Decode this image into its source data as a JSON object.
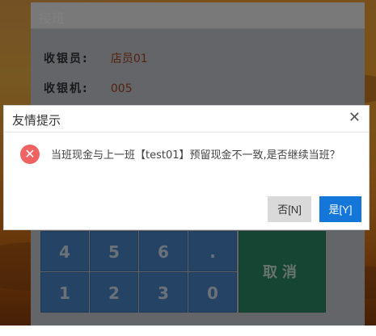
{
  "shift_panel": {
    "title": "接班",
    "cashier_label": "收银员:",
    "cashier_value": "店员01",
    "register_label": "收银机:",
    "register_value": "005",
    "keypad": {
      "keys_row1": [
        "4",
        "5",
        "6",
        "."
      ],
      "keys_row2": [
        "1",
        "2",
        "3",
        "0"
      ],
      "cancel_label": "取消"
    }
  },
  "dialog": {
    "title": "友情提示",
    "close_icon": "close-icon",
    "error_icon": "error-icon",
    "message": "当班现金与上一班【test01】预留现金不一致,是否继续当班？",
    "no_label": "否[N]",
    "yes_label": "是[Y]"
  },
  "colors": {
    "primary_button": "#1476d8",
    "error_icon": "#f06363",
    "keypad_blue": "#4b87c9",
    "keypad_green": "#2f8a67"
  }
}
